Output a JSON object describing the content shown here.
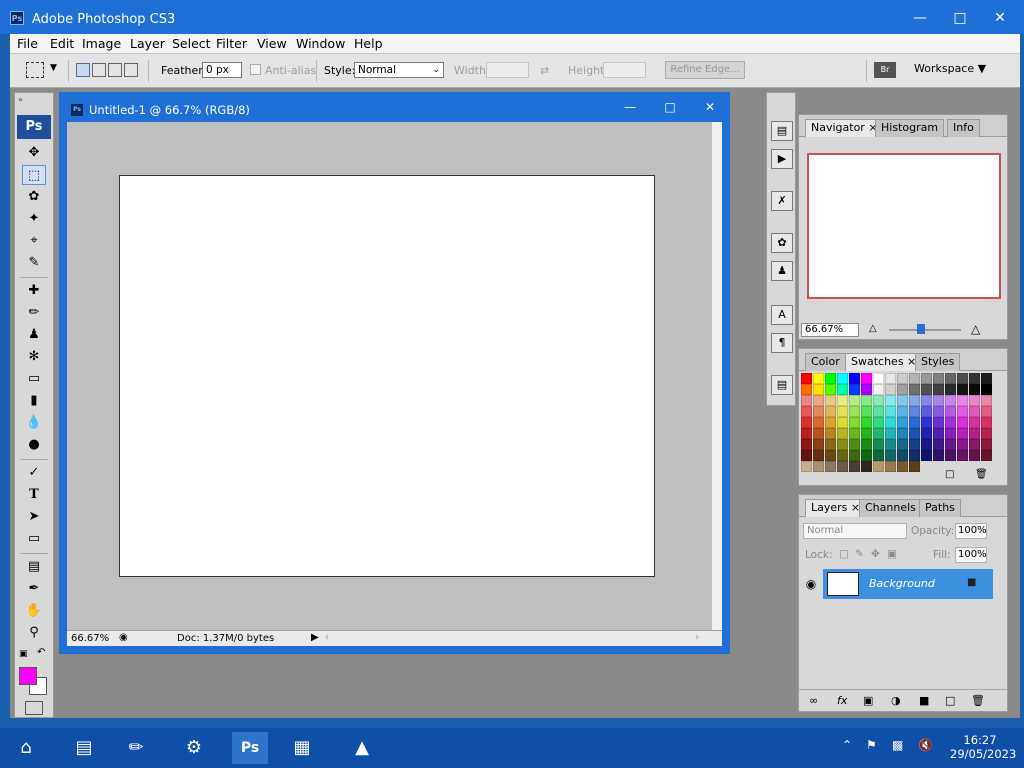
{
  "window": {
    "title": "Adobe Photoshop CS3",
    "app_icon": "Ps"
  },
  "menu": [
    "File",
    "Edit",
    "Image",
    "Layer",
    "Select",
    "Filter",
    "View",
    "Window",
    "Help"
  ],
  "options": {
    "feather_label": "Feather:",
    "feather_value": "0 px",
    "antialias_label": "Anti-alias",
    "style_label": "Style:",
    "style_value": "Normal",
    "width_label": "Width:",
    "height_label": "Height:",
    "refine_edge": "Refine Edge...",
    "workspace": "Workspace ▼"
  },
  "toolbox": {
    "logo": "Ps"
  },
  "document": {
    "title": "Untitled-1 @ 66.7% (RGB/8)",
    "icon": "Ps",
    "zoom": "66.67%",
    "doc_info": "Doc: 1.37M/0 bytes"
  },
  "navigator_panel": {
    "tabs": [
      "Navigator",
      "Histogram",
      "Info"
    ],
    "zoom": "66.67%"
  },
  "color_panel": {
    "tabs": [
      "Color",
      "Swatches",
      "Styles"
    ]
  },
  "layers_panel": {
    "tabs": [
      "Layers",
      "Channels",
      "Paths"
    ],
    "blend_mode": "Normal",
    "opacity_label": "Opacity:",
    "opacity": "100%",
    "lock_label": "Lock:",
    "fill_label": "Fill:",
    "fill": "100%",
    "layer_name": "Background"
  },
  "taskbar": {
    "time": "16:27",
    "date": "29/05/2023"
  },
  "colors": {
    "titlebar": "#1f6fd6",
    "foreground": "#ff00ff",
    "background": "#ffffff",
    "layer_selected": "#3d90e0"
  }
}
